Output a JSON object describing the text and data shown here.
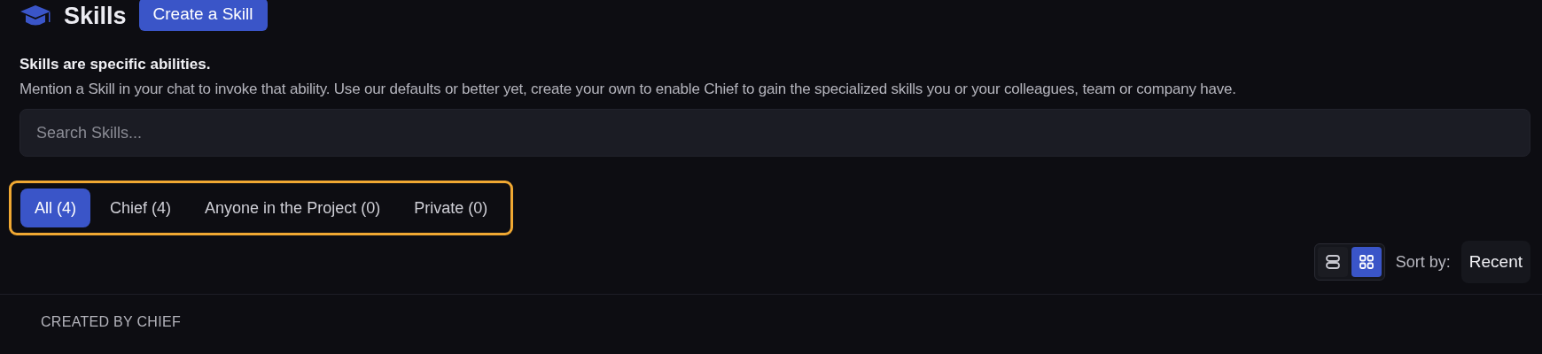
{
  "header": {
    "title": "Skills",
    "create_button": "Create a Skill"
  },
  "intro": {
    "heading": "Skills are specific abilities.",
    "description": "Mention a Skill in your chat to invoke that ability. Use our defaults or better yet, create your own to enable Chief to gain the specialized skills you or your colleagues, team or company have."
  },
  "search": {
    "placeholder": "Search Skills..."
  },
  "tabs": [
    {
      "label": "All (4)",
      "selected": true
    },
    {
      "label": "Chief (4)",
      "selected": false
    },
    {
      "label": "Anyone in the Project (0)",
      "selected": false
    },
    {
      "label": "Private (0)",
      "selected": false
    }
  ],
  "view_modes": [
    {
      "kind": "list",
      "selected": false
    },
    {
      "kind": "grid",
      "selected": true
    }
  ],
  "sort": {
    "label": "Sort by:",
    "value": "Recent"
  },
  "section": {
    "heading": "CREATED BY CHIEF"
  }
}
